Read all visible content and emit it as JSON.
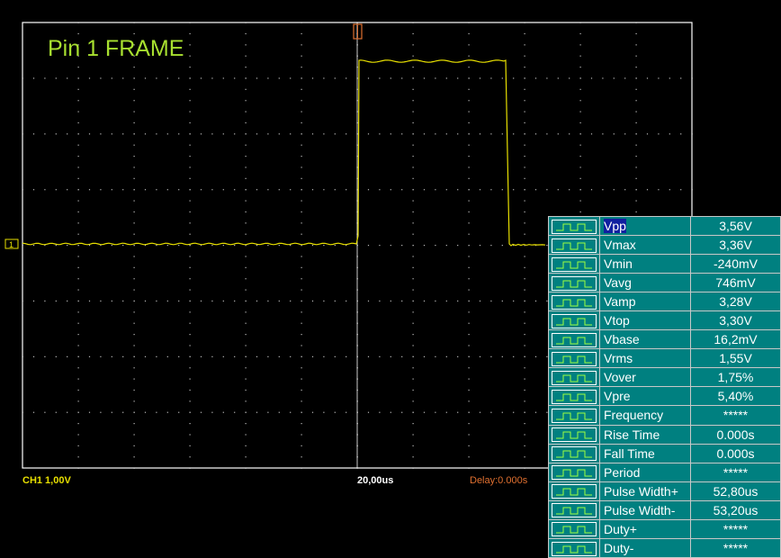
{
  "title": "Pin 1 FRAME",
  "status": {
    "channel": "CH1 1,00V",
    "timebase": "20,00us",
    "delay": "Delay:0.000s"
  },
  "trace_markers": {
    "channel_marker": "1",
    "trigger_marker": "T"
  },
  "measurements": [
    {
      "name": "Vpp",
      "value": "3,56V",
      "icon": "vpp-icon",
      "selected": true
    },
    {
      "name": "Vmax",
      "value": "3,36V",
      "icon": "vmax-icon"
    },
    {
      "name": "Vmin",
      "value": "-240mV",
      "icon": "vmin-icon"
    },
    {
      "name": "Vavg",
      "value": "746mV",
      "icon": "vavg-icon"
    },
    {
      "name": "Vamp",
      "value": "3,28V",
      "icon": "vamp-icon"
    },
    {
      "name": "Vtop",
      "value": "3,30V",
      "icon": "vtop-icon"
    },
    {
      "name": "Vbase",
      "value": "16,2mV",
      "icon": "vbase-icon"
    },
    {
      "name": "Vrms",
      "value": "1,55V",
      "icon": "vrms-icon"
    },
    {
      "name": "Vover",
      "value": "1,75%",
      "icon": "vover-icon"
    },
    {
      "name": "Vpre",
      "value": "5,40%",
      "icon": "vpre-icon"
    },
    {
      "name": "Frequency",
      "value": "*****",
      "icon": "frequency-icon"
    },
    {
      "name": "Rise Time",
      "value": "0.000s",
      "icon": "rise-time-icon"
    },
    {
      "name": "Fall Time",
      "value": "0.000s",
      "icon": "fall-time-icon"
    },
    {
      "name": "Period",
      "value": "*****",
      "icon": "period-icon"
    },
    {
      "name": "Pulse Width+",
      "value": "52,80us",
      "icon": "pulse-width-pos-icon"
    },
    {
      "name": "Pulse Width-",
      "value": "53,20us",
      "icon": "pulse-width-neg-icon"
    },
    {
      "name": "Duty+",
      "value": "*****",
      "icon": "duty-pos-icon"
    },
    {
      "name": "Duty-",
      "value": "*****",
      "icon": "duty-neg-icon"
    }
  ],
  "colors": {
    "trace": "#e8e000",
    "grid": "#ffffff",
    "title": "#a8e030",
    "panel": "#008080",
    "trigger": "#e07030"
  }
}
